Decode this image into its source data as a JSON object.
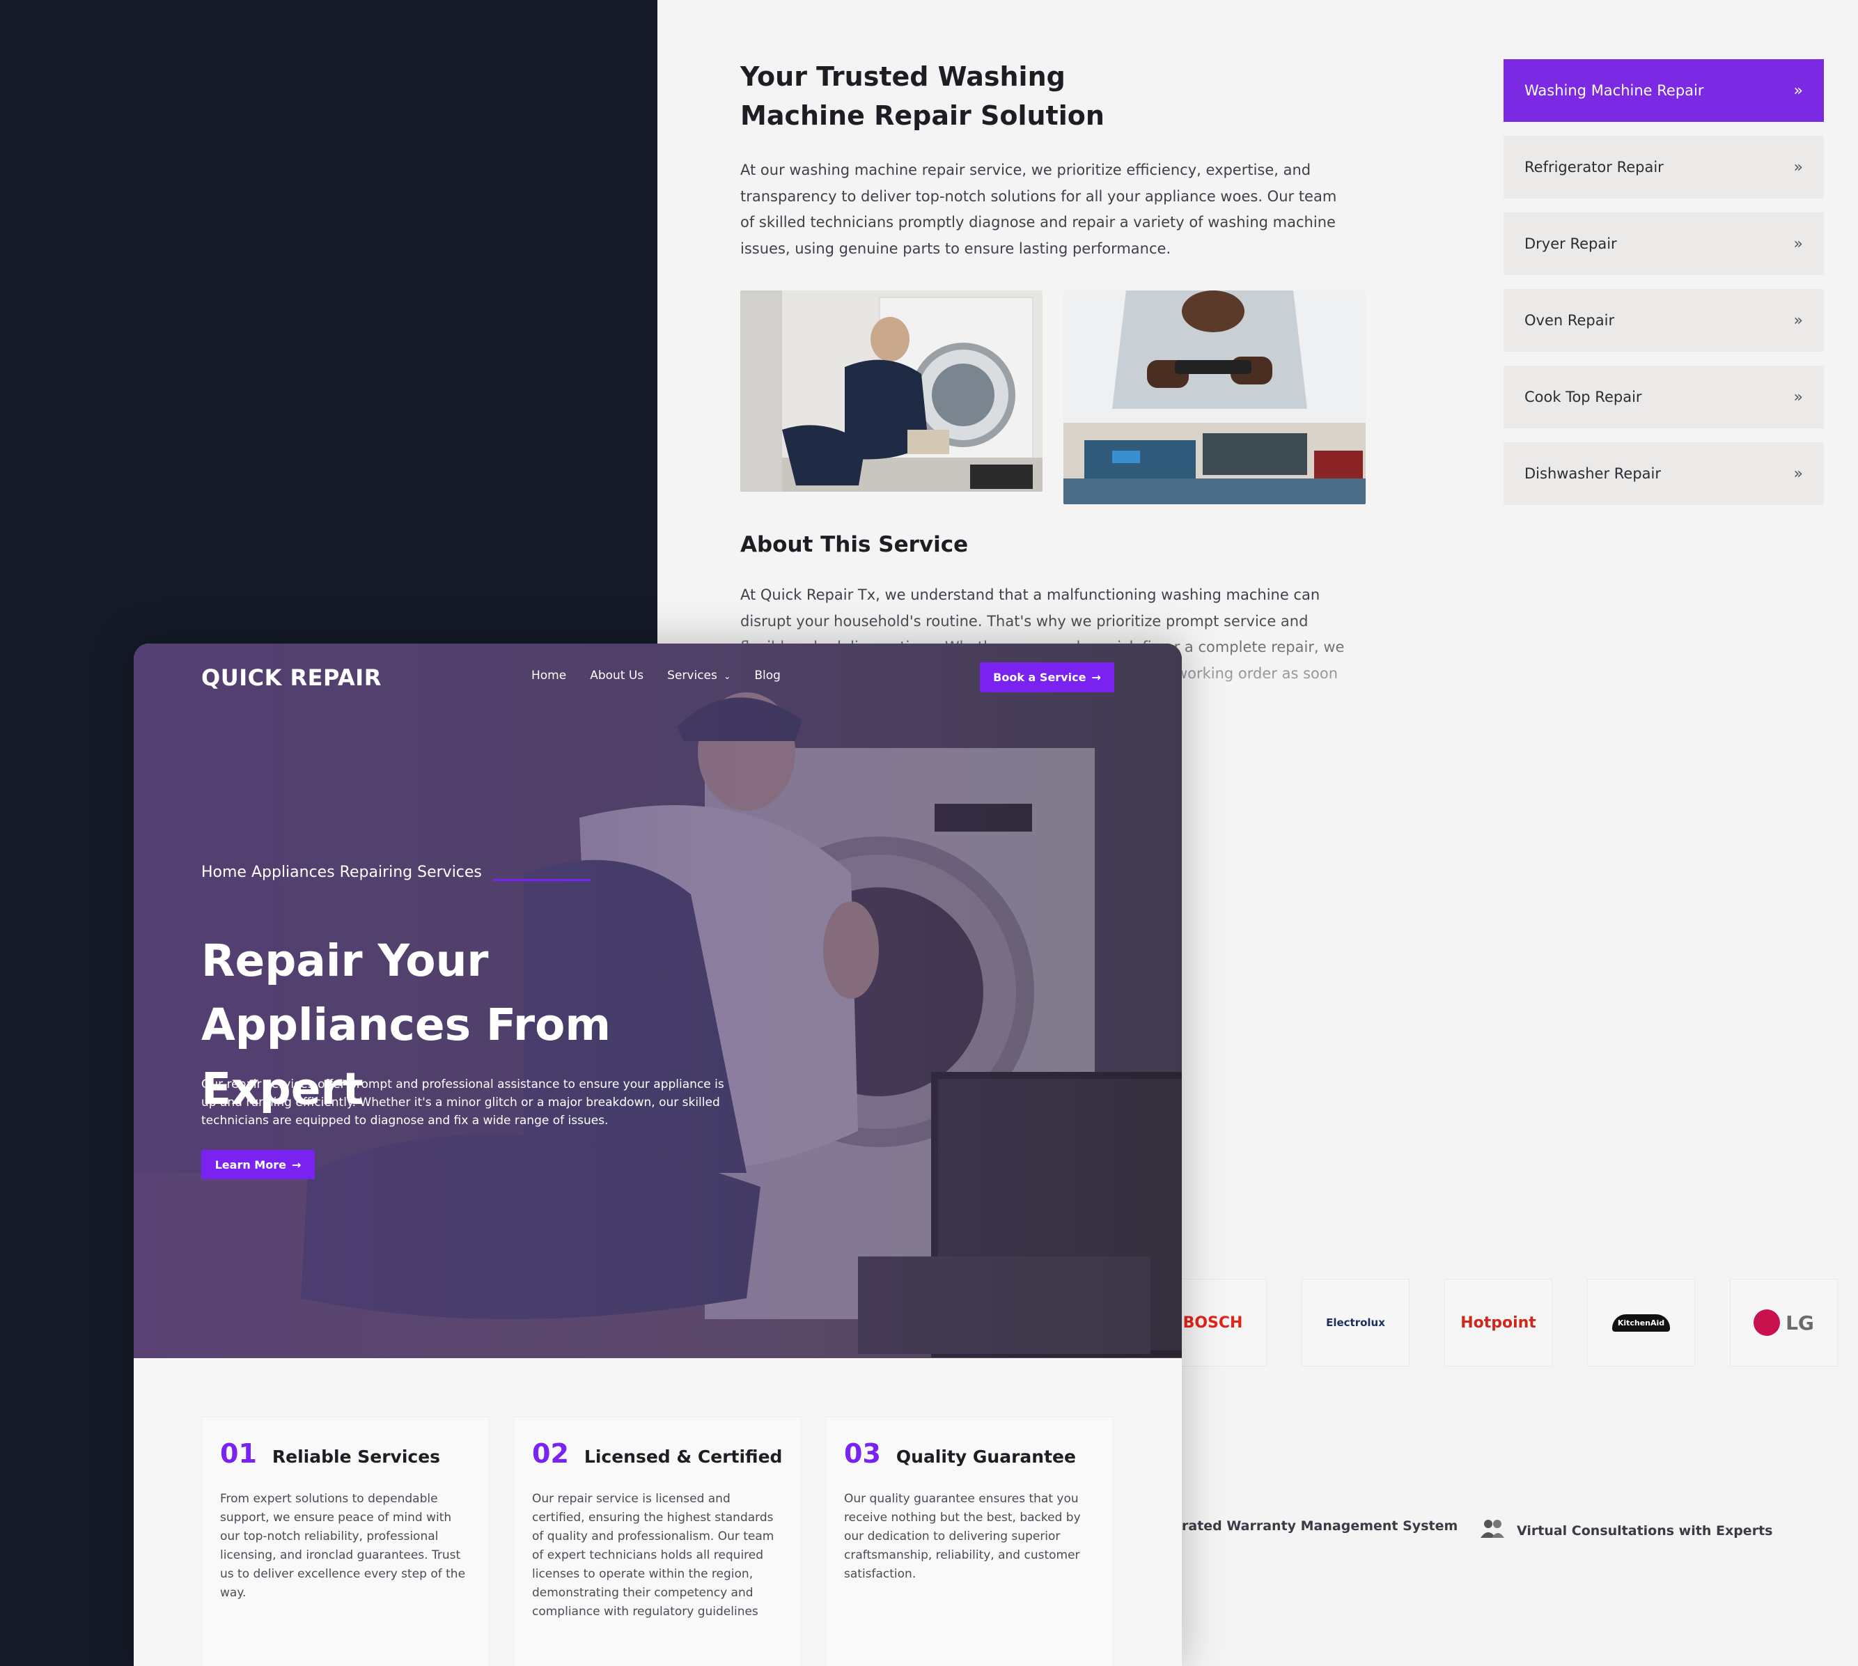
{
  "back_page": {
    "title": "Your Trusted Washing Machine Repair Solution",
    "intro": "At our washing machine repair service, we prioritize efficiency, expertise, and transparency to deliver top-notch solutions for all your appliance woes. Our team of skilled technicians promptly diagnose and repair a variety of washing machine issues, using genuine parts to ensure lasting performance.",
    "about_heading": "About This Service",
    "about_text": "At Quick Repair Tx, we understand that a malfunctioning washing machine can disrupt your household's routine. That's why we prioritize prompt service and flexible scheduling options. Whether you need a quick fix or a complete repair, we work tirelessly to restore your washing machine to optimal working order as soon as possible.",
    "sidebar": [
      {
        "label": "Washing Machine Repair",
        "active": true
      },
      {
        "label": "Refrigerator Repair",
        "active": false
      },
      {
        "label": "Dryer Repair",
        "active": false
      },
      {
        "label": "Oven Repair",
        "active": false
      },
      {
        "label": "Cook Top Repair",
        "active": false
      },
      {
        "label": "Dishwasher Repair",
        "active": false
      }
    ],
    "brands": [
      "BOSCH",
      "Electrolux",
      "Hotpoint",
      "KitchenAid",
      "LG"
    ],
    "features": [
      "rated Warranty Management System",
      "Virtual Consultations with Experts"
    ]
  },
  "front_page": {
    "logo": "QUICK REPAIR",
    "nav": [
      "Home",
      "About Us",
      "Services",
      "Blog"
    ],
    "book_button": "Book a Service",
    "eyebrow": "Home Appliances Repairing Services",
    "hero_title": "Repair Your Appliances From Expert",
    "hero_text": "Our repair services offer prompt and professional assistance to ensure your appliance is up and running efficiently. Whether it's a minor glitch or a major breakdown, our skilled technicians are equipped to diagnose and fix a wide range of issues.",
    "learn_button": "Learn More",
    "cards": [
      {
        "num": "01",
        "title": "Reliable Services",
        "text": "From expert solutions to dependable support, we ensure peace of mind with our top-notch reliability, professional licensing, and ironclad guarantees. Trust us to deliver excellence every step of the way."
      },
      {
        "num": "02",
        "title": "Licensed & Certified",
        "text": "Our repair service is licensed and certified, ensuring the highest standards of quality and professionalism. Our team of expert technicians holds all required licenses to operate within the region, demonstrating their competency and compliance with regulatory guidelines"
      },
      {
        "num": "03",
        "title": "Quality Guarantee",
        "text": "Our quality guarantee ensures that you receive nothing but the best, backed by our dedication to delivering superior craftsmanship, reliability, and customer satisfaction."
      }
    ]
  },
  "colors": {
    "accent": "#7a22f0",
    "dark_panel": "#141b27",
    "hero_tint": "#563e78"
  },
  "icons": [
    "double-chevron-right-icon",
    "chevron-down-icon",
    "arrow-right-icon",
    "users-icon"
  ]
}
